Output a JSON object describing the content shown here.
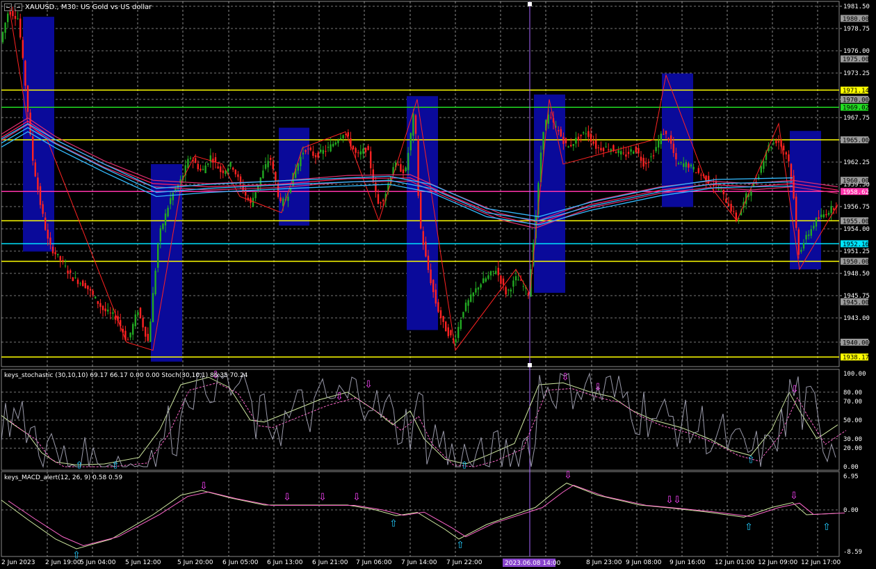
{
  "header": {
    "symbol_text": "XAUUSD., M30:  US Gold vs US dollar"
  },
  "stochastic": {
    "title": "keys_stochastic (30,10,10) 69.17 66.17 0.00 0.00 Stoch(30,10,1) 86.35 70.24"
  },
  "macd": {
    "title": "keys_MACD_alert(12, 26, 9) 0.58 0.59"
  },
  "price_axis": [
    "1981.50",
    "1978.75",
    "1976.00",
    "1973.25",
    "1970.00",
    "1967.75",
    "1965.00",
    "1962.25",
    "1959.50",
    "1956.75",
    "1954.00",
    "1951.25",
    "1948.50",
    "1945.75",
    "1943.00",
    "1940.00"
  ],
  "price_tags": [
    {
      "text": "1980.00",
      "color": "#9a9a9a",
      "fg": "#000"
    },
    {
      "text": "1975.00",
      "color": "#9a9a9a",
      "fg": "#000"
    },
    {
      "text": "1971.14",
      "color": "#ffff00",
      "fg": "#000"
    },
    {
      "text": "1970.00",
      "color": "#9a9a9a",
      "fg": "#000"
    },
    {
      "text": "1969.02",
      "color": "#22dd22",
      "fg": "#000"
    },
    {
      "text": "1965.00",
      "color": "#9a9a9a",
      "fg": "#000"
    },
    {
      "text": "1960.00",
      "color": "#9a9a9a",
      "fg": "#000"
    },
    {
      "text": "1958.62",
      "color": "#ff33aa",
      "fg": "#fff"
    },
    {
      "text": "1955.00",
      "color": "#9a9a9a",
      "fg": "#000"
    },
    {
      "text": "1952.16",
      "color": "#00e5ff",
      "fg": "#000"
    },
    {
      "text": "1950.00",
      "color": "#9a9a9a",
      "fg": "#000"
    },
    {
      "text": "1945.00",
      "color": "#9a9a9a",
      "fg": "#000"
    },
    {
      "text": "1940.00",
      "color": "#9a9a9a",
      "fg": "#000"
    },
    {
      "text": "1938.17",
      "color": "#ffff00",
      "fg": "#000"
    }
  ],
  "stoch_axis": [
    "100.00",
    "80.00",
    "70.00",
    "50.00",
    "30.00",
    "20.00",
    "0.00"
  ],
  "macd_axis": [
    "6.95",
    "0.00",
    "-8.59"
  ],
  "time_axis": [
    "2 Jun 2023",
    "2 Jun 19:00",
    "5 Jun 04:00",
    "5 Jun 12:00",
    "5 Jun 20:00",
    "6 Jun 05:00",
    "6 Jun 13:00",
    "6 Jun 21:00",
    "7 Jun 06:00",
    "7 Jun 14:00",
    "7 Jun 22:00",
    "8 Jun 23:00",
    "9 Jun 08:00",
    "9 Jun 16:00",
    "12 Jun 01:00",
    "12 Jun 09:00",
    "12 Jun 17:00"
  ],
  "crosshair_time": "2023.06.08 14:00",
  "colors": {
    "bull": "#22aa22",
    "bear": "#ff2222",
    "box": "#0a0a9a",
    "grid": "#c8c8c8",
    "ma": "#ff2266",
    "ma_blue": "#33bbff"
  }
}
